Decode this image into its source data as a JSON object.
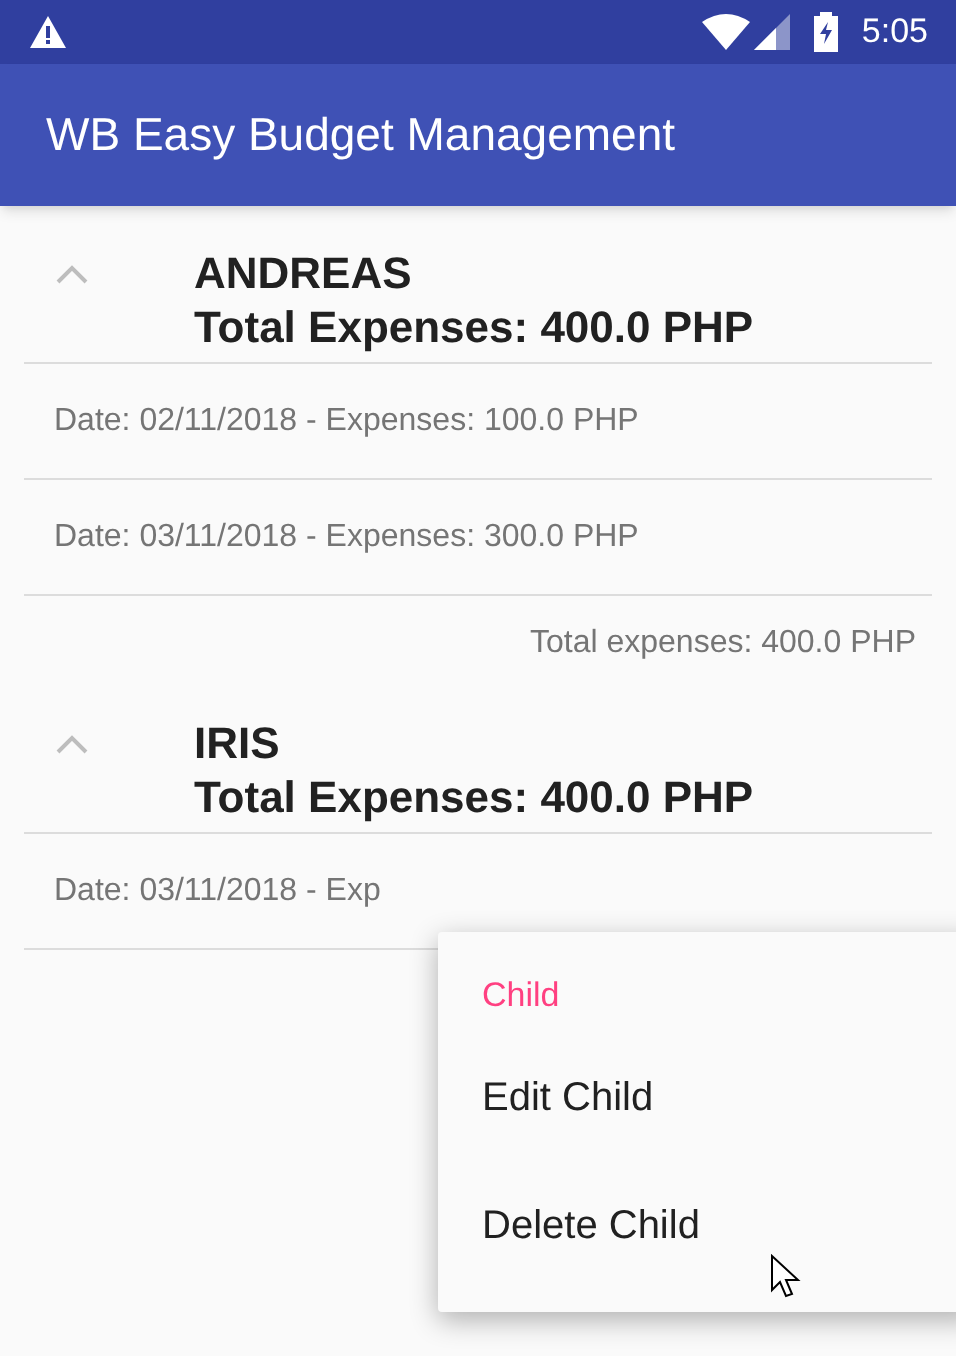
{
  "status_bar": {
    "time": "5:05"
  },
  "app_bar": {
    "title": "WB Easy Budget Management"
  },
  "groups": [
    {
      "name": "ANDREAS",
      "total": "Total Expenses: 400.0 PHP",
      "expanded": true,
      "children": [
        "Date: 02/11/2018 - Expenses: 100.0 PHP",
        "Date: 03/11/2018 - Expenses: 300.0 PHP"
      ],
      "footer": "Total expenses: 400.0 PHP"
    },
    {
      "name": "IRIS",
      "total": "Total Expenses: 400.0 PHP",
      "expanded": true,
      "children": [
        "Date: 03/11/2018 - Exp"
      ]
    }
  ],
  "context_menu": {
    "title": "Child",
    "items": [
      "Edit Child",
      "Delete Child"
    ]
  }
}
